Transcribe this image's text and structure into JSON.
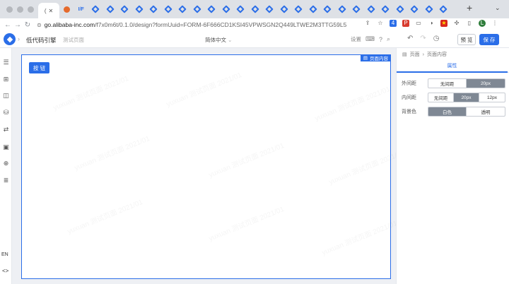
{
  "browser": {
    "active_tab_label": "(",
    "tab_text_badge": "I/F",
    "url_host": "go.alibaba-inc.com",
    "url_path": "/f7x0m6t/0.1.0/design?formUuid=FORM-6F666CD1KSI45VPWSGN2Q449LTWE2M3TTG59L5",
    "new_tab": "+",
    "ext_badge": "4",
    "profile_initial": "L"
  },
  "header": {
    "app_name": "低代码引擎",
    "page_name": "测试页面",
    "language": "简体中文",
    "setting_label": "设置",
    "preview_label": "预 览",
    "save_label": "保 存"
  },
  "sidebar": {
    "language": "EN",
    "code_toggle": "<>"
  },
  "canvas": {
    "page_tag": "页面内容",
    "button_label": "按 钮",
    "watermark": "yuxuan 测试页面 2021/01"
  },
  "panel": {
    "breadcrumb": [
      "页面",
      "页面内容"
    ],
    "tab_label": "属性",
    "rows": [
      {
        "label": "外间距",
        "options": [
          "无间距",
          "20px"
        ],
        "selected": 1
      },
      {
        "label": "内间距",
        "options": [
          "无间距",
          "20px",
          "12px"
        ],
        "selected": 1
      },
      {
        "label": "背景色",
        "options": [
          "白色",
          "透明"
        ],
        "selected": 0
      }
    ]
  },
  "colors": {
    "primary": "#2b6ee8",
    "selected_segment": "#7f8894"
  }
}
